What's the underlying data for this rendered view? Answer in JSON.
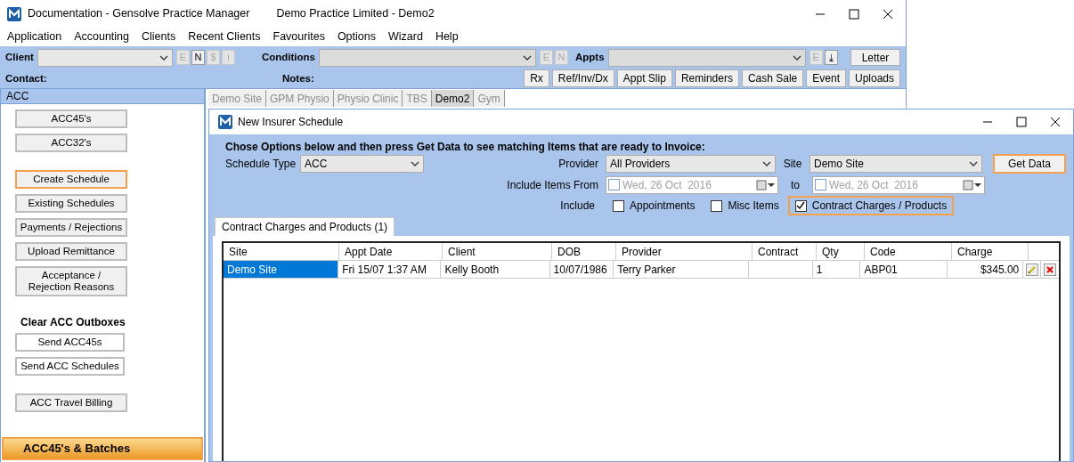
{
  "window": {
    "title": "Documentation - Gensolve Practice Manager",
    "subtitle": "Demo Practice Limited - Demo2"
  },
  "menu": [
    "Application",
    "Accounting",
    "Clients",
    "Recent Clients",
    "Favourites",
    "Options",
    "Wizard",
    "Help"
  ],
  "toolbar": {
    "client_label": "Client",
    "client_buttons": [
      {
        "label": "E",
        "disabled": true
      },
      {
        "label": "N",
        "disabled": false
      },
      {
        "label": "$",
        "disabled": true
      },
      {
        "label": "i",
        "disabled": true
      }
    ],
    "conditions_label": "Conditions",
    "conditions_buttons": [
      {
        "label": "E",
        "disabled": true
      },
      {
        "label": "N",
        "disabled": true
      }
    ],
    "appts_label": "Appts",
    "appts_buttons": [
      {
        "label": "E",
        "disabled": true
      },
      {
        "label": "⤓",
        "disabled": false
      }
    ],
    "letter": "Letter",
    "contact_label": "Contact:",
    "notes_label": "Notes:",
    "actions": [
      "Rx",
      "Ref/Inv/Dx",
      "Appt Slip",
      "Reminders",
      "Cash Sale",
      "Event",
      "Uploads"
    ]
  },
  "sidebar": {
    "title": "ACC",
    "items": [
      {
        "kind": "button",
        "label": "ACC45's",
        "highlighted": false
      },
      {
        "kind": "button",
        "label": "ACC32's",
        "highlighted": false
      },
      {
        "kind": "gap"
      },
      {
        "kind": "button",
        "label": "Create Schedule",
        "highlighted": true
      },
      {
        "kind": "button",
        "label": "Existing Schedules",
        "highlighted": false
      },
      {
        "kind": "button",
        "label": "Payments / Rejections",
        "highlighted": false
      },
      {
        "kind": "button",
        "label": "Upload Remittance",
        "highlighted": false
      },
      {
        "kind": "button",
        "label": "Acceptance /\nRejection Reasons",
        "highlighted": false
      },
      {
        "kind": "gap"
      },
      {
        "kind": "heading",
        "label": "Clear ACC Outboxes"
      },
      {
        "kind": "white-button",
        "label": "Send ACC45s",
        "highlighted": false
      },
      {
        "kind": "white-button",
        "label": "Send ACC Schedules",
        "highlighted": false
      },
      {
        "kind": "gap"
      },
      {
        "kind": "button",
        "label": "ACC Travel Billing",
        "highlighted": false
      }
    ],
    "footer": {
      "label": "ACC45's & Batches",
      "highlighted": true
    }
  },
  "site_tabs": [
    {
      "label": "Demo Site",
      "selected": false
    },
    {
      "label": "GPM Physio",
      "selected": false
    },
    {
      "label": "Physio Clinic",
      "selected": false
    },
    {
      "label": "TBS",
      "selected": false
    },
    {
      "label": "Demo2",
      "selected": true
    },
    {
      "label": "Gym",
      "selected": false
    }
  ],
  "dialog": {
    "title": "New Insurer Schedule",
    "instruction": "Chose Options below and then press Get Data to see matching Items that are ready to Invoice:",
    "schedule_type": {
      "label": "Schedule Type",
      "value": "ACC"
    },
    "provider": {
      "label": "Provider",
      "value": "All Providers"
    },
    "site": {
      "label": "Site",
      "value": "Demo Site"
    },
    "get_data": {
      "label": "Get Data",
      "highlighted": true
    },
    "from": {
      "label": "Include Items From",
      "value": "Wed, 26 Oct  2016",
      "checked": false
    },
    "to": {
      "label": "to",
      "value": "Wed, 26 Oct  2016",
      "checked": false
    },
    "include_label": "Include",
    "includes": [
      {
        "label": "Appointments",
        "checked": false,
        "highlighted": false
      },
      {
        "label": "Misc Items",
        "checked": false,
        "highlighted": false
      },
      {
        "label": "Contract Charges / Products",
        "checked": true,
        "highlighted": true
      }
    ],
    "tabs": [
      {
        "label": "Contract Charges and Products (1)",
        "selected": true
      }
    ],
    "table": {
      "columns": [
        "Site",
        "Appt Date",
        "Client",
        "DOB",
        "Provider",
        "Contract",
        "Qty",
        "Code",
        "Charge"
      ],
      "rows": [
        {
          "selected": true,
          "cells": [
            "Demo Site",
            "Fri 15/07 1:37 AM",
            "Kelly Booth",
            "10/07/1986",
            "Terry Parker",
            "",
            "1",
            "ABP01",
            "$345.00"
          ]
        }
      ]
    }
  }
}
